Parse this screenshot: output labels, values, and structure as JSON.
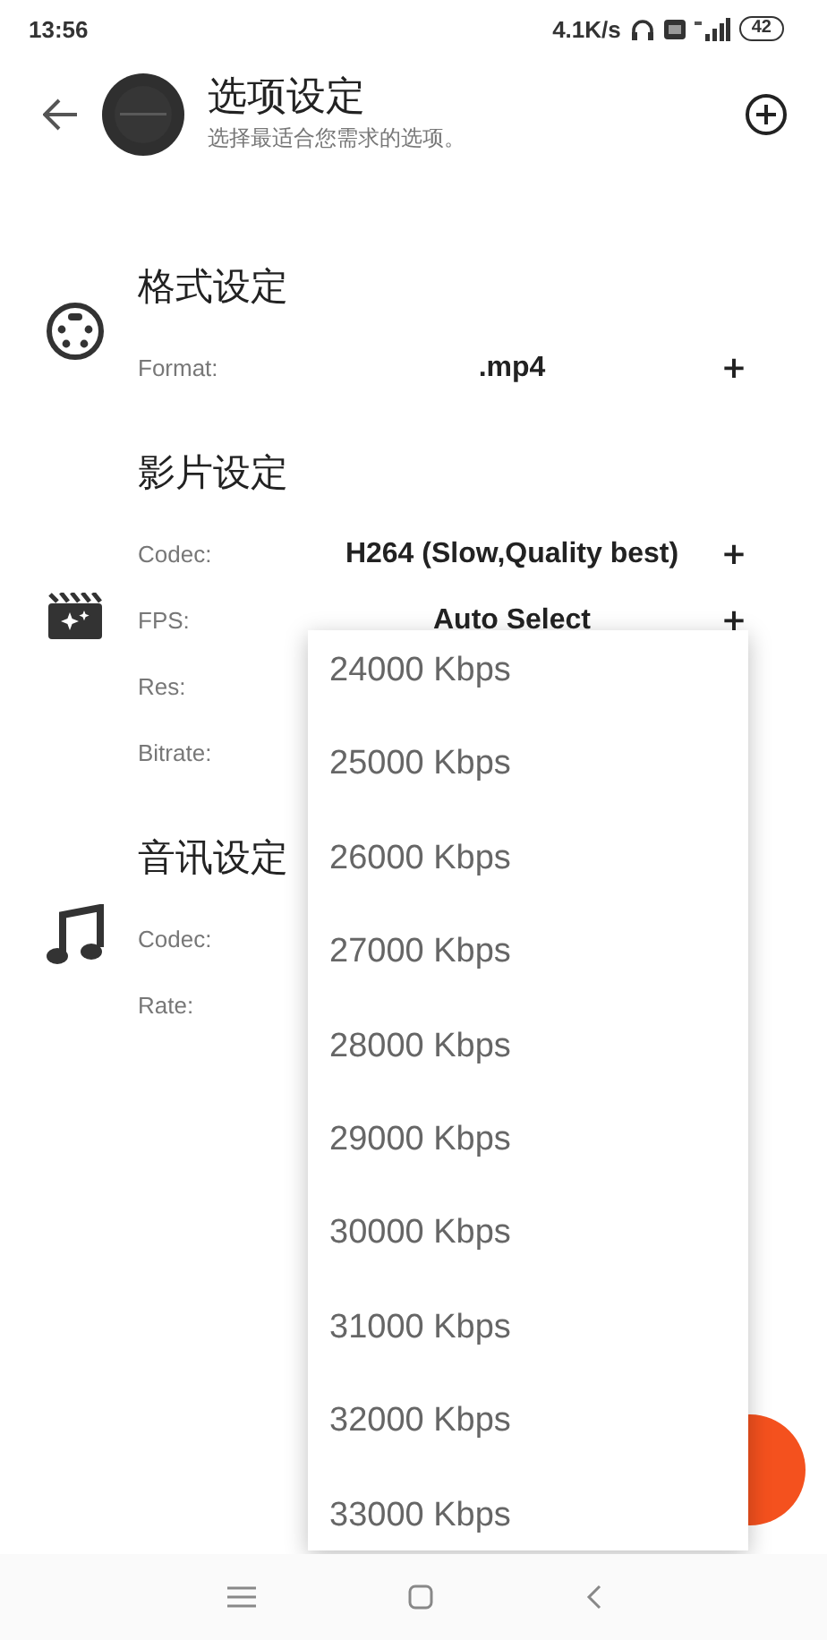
{
  "status_bar": {
    "time": "13:56",
    "net_speed": "4.1K/s",
    "battery": "42"
  },
  "header": {
    "title": "选项设定",
    "subtitle": "选择最适合您需求的选项。"
  },
  "sections": [
    {
      "kind": "format",
      "title": "格式设定",
      "rows": [
        {
          "label": "Format:",
          "value": ".mp4",
          "action": "+"
        }
      ]
    },
    {
      "kind": "video",
      "title": "影片设定",
      "rows": [
        {
          "label": "Codec:",
          "value": "H264 (Slow,Quality best)",
          "action": "+"
        },
        {
          "label": "FPS:",
          "value": "Auto Select",
          "action": "+"
        },
        {
          "label": "Res:"
        },
        {
          "label": "Bitrate:"
        }
      ]
    },
    {
      "kind": "audio",
      "title": "音讯设定",
      "rows": [
        {
          "label": "Codec:"
        },
        {
          "label": "Rate:"
        }
      ]
    }
  ],
  "dropdown": {
    "options": [
      "24000 Kbps",
      "25000 Kbps",
      "26000 Kbps",
      "27000 Kbps",
      "28000 Kbps",
      "29000 Kbps",
      "30000 Kbps",
      "31000 Kbps",
      "32000 Kbps",
      "33000 Kbps"
    ]
  },
  "fab": {
    "kind": "round"
  }
}
